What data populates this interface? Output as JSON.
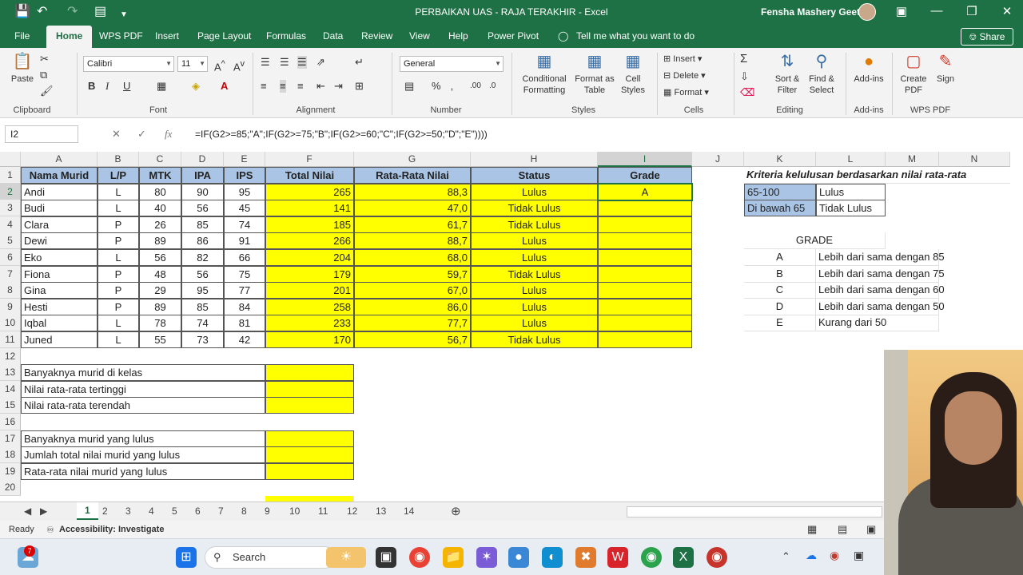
{
  "window": {
    "title": "PERBAIKAN UAS  -  RAJA TERAKHIR  -  Excel",
    "user": "Fensha Mashery Geetio"
  },
  "menu": {
    "tabs": [
      "File",
      "Home",
      "WPS PDF",
      "Insert",
      "Page Layout",
      "Formulas",
      "Data",
      "Review",
      "View",
      "Help",
      "Power Pivot"
    ],
    "active": "Home",
    "tell_me": "Tell me what you want to do",
    "share": "Share"
  },
  "ribbon": {
    "paste": "Paste",
    "font_name": "Calibri",
    "font_size": "11",
    "number_format": "General",
    "conditional_formatting": "Conditional Formatting",
    "format_as_table": "Format as Table",
    "cell_styles": "Cell Styles",
    "insert": "Insert",
    "delete": "Delete",
    "format": "Format",
    "sort_filter": "Sort & Filter",
    "find_select": "Find & Select",
    "add_ins": "Add-ins",
    "create_pdf": "Create PDF",
    "sign": "Sign",
    "groups": {
      "clipboard": "Clipboard",
      "font": "Font",
      "alignment": "Alignment",
      "number": "Number",
      "styles": "Styles",
      "cells": "Cells",
      "editing": "Editing",
      "addins": "Add-ins",
      "wpspdf": "WPS PDF"
    }
  },
  "formula_bar": {
    "name_box": "I2",
    "formula": "=IF(G2>=85;\"A\";IF(G2>=75;\"B\";IF(G2>=60;\"C\";IF(G2>=50;\"D\";\"E\"))))"
  },
  "columns": [
    "A",
    "B",
    "C",
    "D",
    "E",
    "F",
    "G",
    "H",
    "I",
    "J",
    "K",
    "L",
    "M",
    "N"
  ],
  "rows": [
    "1",
    "2",
    "3",
    "4",
    "5",
    "6",
    "7",
    "8",
    "9",
    "10",
    "11",
    "12",
    "13",
    "14",
    "15",
    "16",
    "17",
    "18",
    "19",
    "20"
  ],
  "table": {
    "headers": [
      "Nama Murid",
      "L/P",
      "MTK",
      "IPA",
      "IPS",
      "Total Nilai",
      "Rata-Rata Nilai",
      "Status",
      "Grade"
    ],
    "data": [
      [
        "Andi",
        "L",
        "80",
        "90",
        "95",
        "265",
        "88,3",
        "Lulus",
        "A"
      ],
      [
        "Budi",
        "L",
        "40",
        "56",
        "45",
        "141",
        "47,0",
        "Tidak Lulus",
        ""
      ],
      [
        "Clara",
        "P",
        "26",
        "85",
        "74",
        "185",
        "61,7",
        "Tidak Lulus",
        ""
      ],
      [
        "Dewi",
        "P",
        "89",
        "86",
        "91",
        "266",
        "88,7",
        "Lulus",
        ""
      ],
      [
        "Eko",
        "L",
        "56",
        "82",
        "66",
        "204",
        "68,0",
        "Lulus",
        ""
      ],
      [
        "Fiona",
        "P",
        "48",
        "56",
        "75",
        "179",
        "59,7",
        "Tidak Lulus",
        ""
      ],
      [
        "Gina",
        "P",
        "29",
        "95",
        "77",
        "201",
        "67,0",
        "Lulus",
        ""
      ],
      [
        "Hesti",
        "P",
        "89",
        "85",
        "84",
        "258",
        "86,0",
        "Lulus",
        ""
      ],
      [
        "Iqbal",
        "L",
        "78",
        "74",
        "81",
        "233",
        "77,7",
        "Lulus",
        ""
      ],
      [
        "Juned",
        "L",
        "55",
        "73",
        "42",
        "170",
        "56,7",
        "Tidak Lulus",
        ""
      ]
    ]
  },
  "summary": [
    "Banyaknya murid di kelas",
    "Nilai rata-rata tertinggi",
    "Nilai rata-rata terendah",
    "Banyaknya murid yang lulus",
    "Jumlah total nilai murid yang lulus",
    "Rata-rata nilai murid yang lulus"
  ],
  "criteria": {
    "title": "Kriteria kelulusan berdasarkan nilai rata-rata",
    "rows": [
      [
        "65-100",
        "Lulus"
      ],
      [
        "Di bawah 65",
        "Tidak Lulus"
      ]
    ],
    "grade_title": "GRADE",
    "grades": [
      [
        "A",
        "Lebih dari sama dengan 85"
      ],
      [
        "B",
        "Lebih dari sama dengan 75"
      ],
      [
        "C",
        "Lebih dari sama dengan 60"
      ],
      [
        "D",
        "Lebih dari sama dengan 50"
      ],
      [
        "E",
        "Kurang dari 50"
      ]
    ]
  },
  "sheet_tabs": [
    "1",
    "2",
    "3",
    "4",
    "5",
    "6",
    "7",
    "8",
    "9",
    "10",
    "11",
    "12",
    "13",
    "14"
  ],
  "active_sheet": "1",
  "status": {
    "ready": "Ready",
    "accessibility": "Accessibility: Investigate"
  },
  "taskbar": {
    "search": "Search",
    "badge": "7"
  },
  "colors": {
    "excel_green": "#1e7145",
    "header_blue": "#a9c4e4",
    "highlight_yellow": "#ffff00"
  }
}
